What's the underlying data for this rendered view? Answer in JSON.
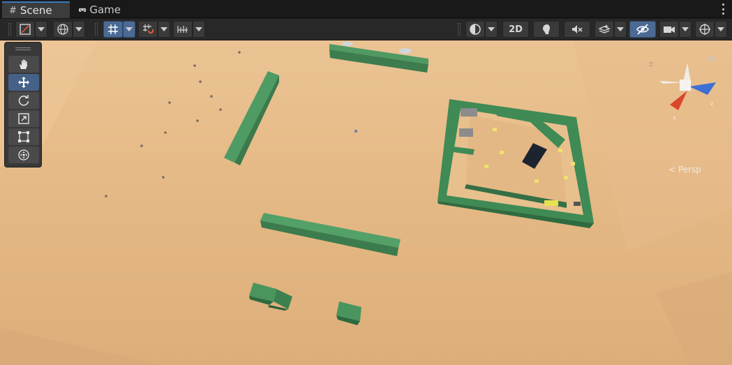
{
  "tabs": [
    {
      "label": "Scene",
      "icon": "hash-icon",
      "active": true
    },
    {
      "label": "Game",
      "icon": "gamepad-icon",
      "active": false
    }
  ],
  "toolbar": {
    "left": [
      "draw-mode",
      "global-local",
      "grid-snapping",
      "increment-snap",
      "ruler"
    ],
    "view_2d_label": "2D",
    "right": [
      "shading-mode",
      "2d",
      "lighting",
      "audio",
      "effects",
      "scene-visibility",
      "camera",
      "gizmos"
    ]
  },
  "palette": {
    "tools": [
      "hand-tool",
      "move-tool",
      "rotate-tool",
      "scale-tool",
      "rect-tool",
      "transform-tool"
    ],
    "selected": "move-tool"
  },
  "gizmo": {
    "y_label": "y",
    "x_label": "x",
    "z_label": "z",
    "projection_label": "< Persp"
  },
  "colors": {
    "ground": "#e3b884",
    "walls": "#3f8a55",
    "selected_tool": "#456187",
    "toolbar_on": "#4b6a94"
  }
}
